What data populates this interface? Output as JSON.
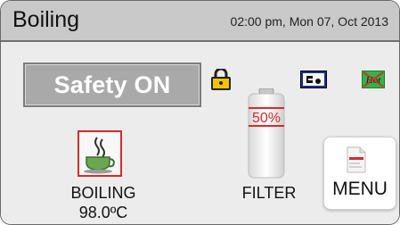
{
  "header": {
    "title": "Boiling",
    "datetime": "02:00 pm, Mon 07, Oct 2013"
  },
  "safety": {
    "label": "Safety ON"
  },
  "status_icons": [
    {
      "name": "lock-icon"
    },
    {
      "name": "control-icon"
    },
    {
      "name": "hot-off-icon",
      "text": "Hot"
    }
  ],
  "boiling": {
    "label": "BOILING",
    "temperature": "98.0ºC"
  },
  "filter": {
    "label": "FILTER",
    "percent_text": "50%",
    "level": 0.5
  },
  "menu": {
    "label": "MENU"
  },
  "colors": {
    "titlebar": "#c9c9c9",
    "safety_bg": "#a9a9a9",
    "alert_red": "#d62b2b",
    "lock_yellow": "#f2c200",
    "control_blue": "#1b2f8f",
    "hot_green": "#35b34a"
  }
}
